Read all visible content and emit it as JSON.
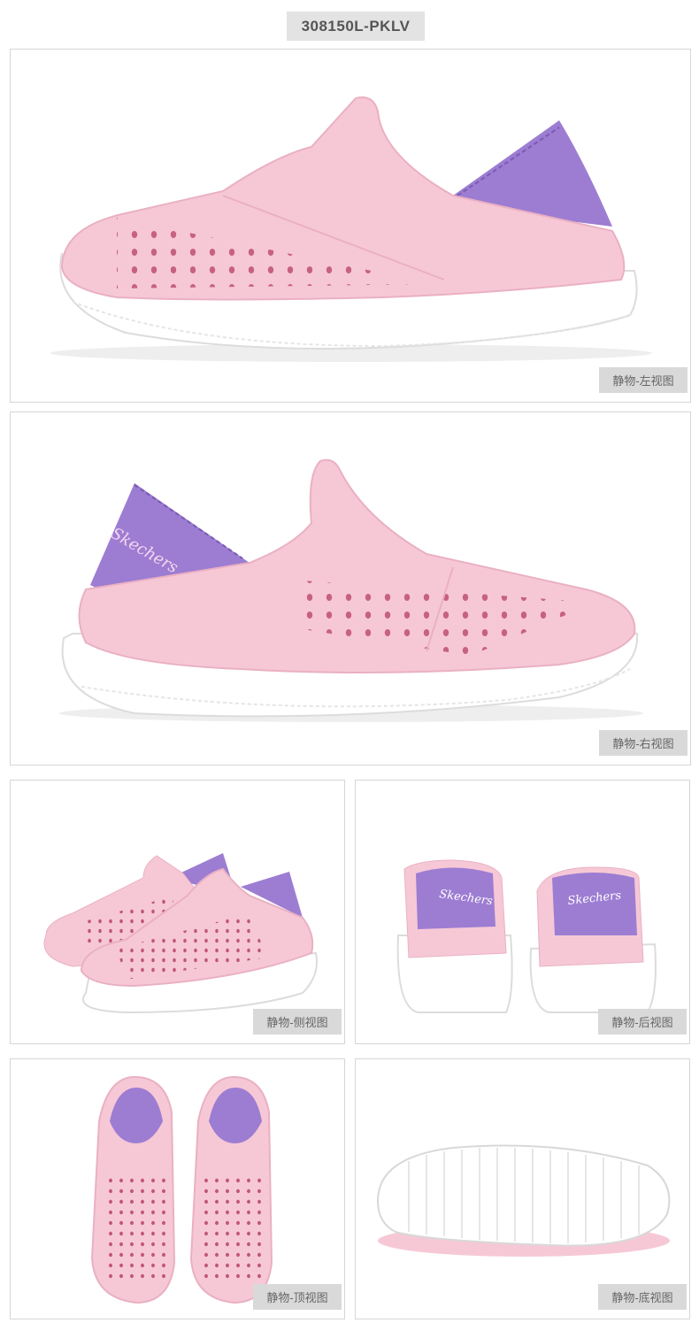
{
  "product": {
    "sku": "308150L-PKLV",
    "brand_mark": "Skechers"
  },
  "colors": {
    "shoe_pink": "#f6c8d6",
    "lining_purple": "#9c7ad0",
    "sole_white": "#ffffff",
    "caption_bg": "#d9d9d9"
  },
  "views": [
    {
      "caption": "静物-左视图"
    },
    {
      "caption": "静物-右视图"
    },
    {
      "caption": "静物-侧视图"
    },
    {
      "caption": "静物-后视图"
    },
    {
      "caption": "静物-顶视图"
    },
    {
      "caption": "静物-底视图"
    }
  ]
}
